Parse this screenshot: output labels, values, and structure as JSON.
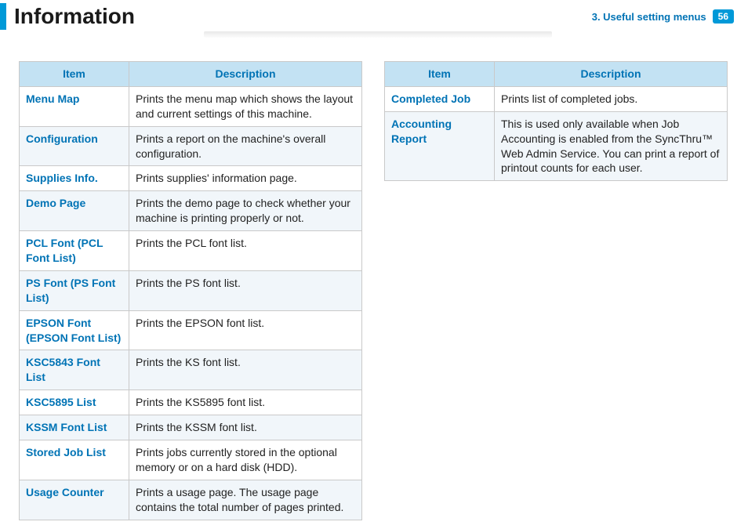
{
  "header": {
    "title": "Information",
    "section": "3.  Useful setting menus",
    "page_number": "56"
  },
  "table_headers": {
    "item": "Item",
    "description": "Description"
  },
  "table_left": [
    {
      "item": "Menu Map",
      "desc": "Prints the menu map which shows the layout and current settings of this machine."
    },
    {
      "item": "Configuration",
      "desc": "Prints a report on the machine's overall configuration."
    },
    {
      "item": "Supplies Info.",
      "desc": "Prints supplies' information page."
    },
    {
      "item": "Demo Page",
      "desc": "Prints the demo page to check whether your machine is printing properly or not."
    },
    {
      "item": "PCL Font (PCL Font List)",
      "desc": "Prints the PCL font list."
    },
    {
      "item": "PS Font (PS Font List)",
      "desc": "Prints the PS font list."
    },
    {
      "item": "EPSON Font (EPSON Font List)",
      "desc": "Prints the EPSON font list."
    },
    {
      "item": "KSC5843 Font List",
      "desc": "Prints the KS font list."
    },
    {
      "item": "KSC5895 List",
      "desc": "Prints the KS5895 font list."
    },
    {
      "item": "KSSM Font List",
      "desc": "Prints the KSSM font list."
    },
    {
      "item": "Stored Job List",
      "desc": "Prints jobs currently stored in the optional memory or on a hard disk (HDD)."
    },
    {
      "item": "Usage Counter",
      "desc": "Prints a usage page. The usage page contains the total number of pages printed."
    }
  ],
  "table_right": [
    {
      "item": "Completed Job",
      "desc": "Prints list of completed jobs."
    },
    {
      "item": "Accounting Report",
      "desc": "This is used only available when Job Accounting is enabled from the SyncThru™ Web Admin Service. You can print a report of printout counts for each user."
    }
  ]
}
